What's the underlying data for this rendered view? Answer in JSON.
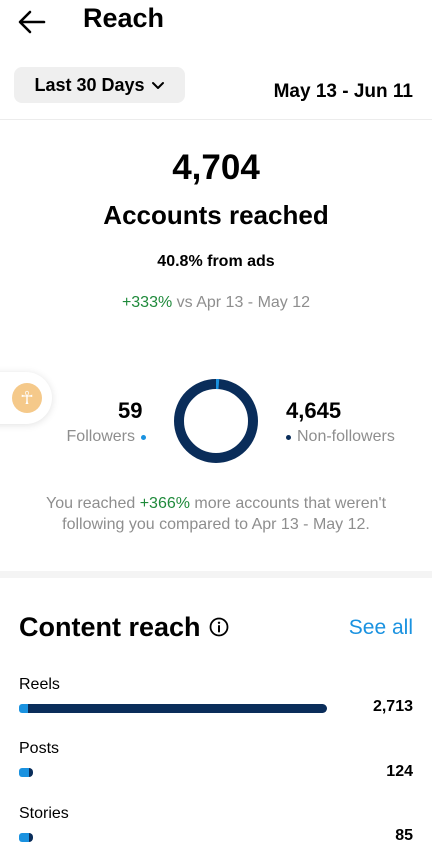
{
  "header": {
    "title": "Reach",
    "back_icon": "arrow-left-icon"
  },
  "filter": {
    "range_label": "Last 30 Days",
    "date_range": "May 13 - Jun 11"
  },
  "summary": {
    "accounts_reached": "4,704",
    "accounts_reached_label": "Accounts reached",
    "from_ads": "40.8% from ads",
    "change_pct": "+333%",
    "change_suffix": " vs Apr 13 - May 12"
  },
  "audience": {
    "followers_count": "59",
    "followers_label": "Followers",
    "non_followers_count": "4,645",
    "non_followers_label": "Non-followers",
    "followers_fraction": 0.0125,
    "colors": {
      "followers": "#1a92e0",
      "non_followers": "#0a2d5a"
    }
  },
  "note": {
    "prefix": "You reached ",
    "pct": "+366%",
    "suffix": " more accounts that weren't following you compared to Apr 13 - May 12."
  },
  "content_reach": {
    "title": "Content reach",
    "see_all": "See all",
    "rows": [
      {
        "label": "Reels",
        "value": "2,713",
        "followers_fraction": 0.03,
        "total": 2713
      },
      {
        "label": "Posts",
        "value": "124",
        "followers_fraction": 0.7,
        "total": 124
      },
      {
        "label": "Stories",
        "value": "85",
        "followers_fraction": 0.7,
        "total": 85
      }
    ]
  }
}
